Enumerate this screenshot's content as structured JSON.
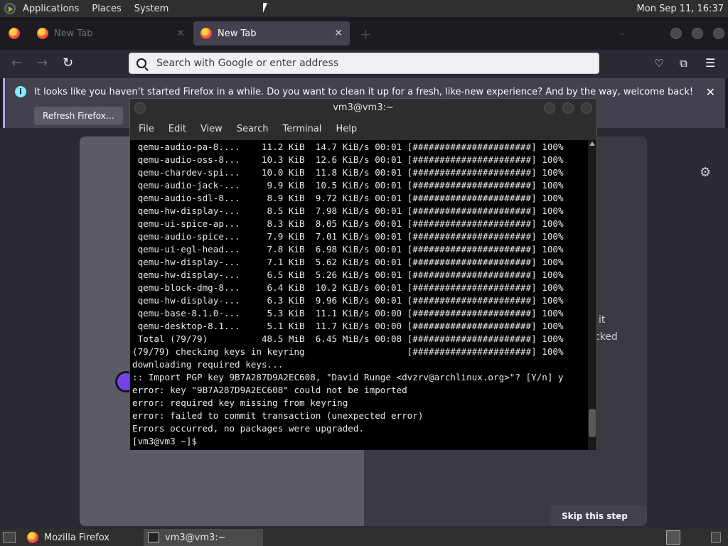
{
  "top_panel": {
    "menus": [
      "Applications",
      "Places",
      "System"
    ],
    "clock": "Mon Sep 11, 16:37"
  },
  "firefox": {
    "tabs": [
      {
        "label": "New Tab",
        "active": false
      },
      {
        "label": "New Tab",
        "active": true
      }
    ],
    "urlbar": {
      "placeholder": "Search with Google or enter address"
    },
    "notification": {
      "message": "It looks like you haven’t started Firefox in a while. Do you want to clean it up for a fresh, like-new experience? And by the way, welcome back!",
      "button": "Refresh Firefox…"
    },
    "onboarding": {
      "partial_text_1": "it",
      "partial_text_2": "cked",
      "skip_button": "Skip this step →",
      "progress_fraction": 0.33
    }
  },
  "terminal": {
    "title": "vm3@vm3:~",
    "menu": [
      "File",
      "Edit",
      "View",
      "Search",
      "Terminal",
      "Help"
    ],
    "lines": [
      " qemu-audio-pa-8....    11.2 KiB  14.7 KiB/s 00:01 [######################] 100%",
      " qemu-audio-oss-8...    10.3 KiB  12.6 KiB/s 00:01 [######################] 100%",
      " qemu-chardev-spi...    10.0 KiB  11.8 KiB/s 00:01 [######################] 100%",
      " qemu-audio-jack-...     9.9 KiB  10.5 KiB/s 00:01 [######################] 100%",
      " qemu-audio-sdl-8...     8.9 KiB  9.72 KiB/s 00:01 [######################] 100%",
      " qemu-hw-display-...     8.5 KiB  7.98 KiB/s 00:01 [######################] 100%",
      " qemu-ui-spice-ap...     8.3 KiB  8.05 KiB/s 00:01 [######################] 100%",
      " qemu-audio-spice...     7.9 KiB  7.01 KiB/s 00:01 [######################] 100%",
      " qemu-ui-egl-head...     7.8 KiB  6.98 KiB/s 00:01 [######################] 100%",
      " qemu-hw-display-...     7.1 KiB  5.62 KiB/s 00:01 [######################] 100%",
      " qemu-hw-display-...     6.5 KiB  5.26 KiB/s 00:01 [######################] 100%",
      " qemu-block-dmg-8...     6.4 KiB  10.2 KiB/s 00:01 [######################] 100%",
      " qemu-hw-display-...     6.3 KiB  9.96 KiB/s 00:01 [######################] 100%",
      " qemu-base-8.1.0-...     5.3 KiB  11.1 KiB/s 00:00 [######################] 100%",
      " qemu-desktop-8.1...     5.1 KiB  11.7 KiB/s 00:00 [######################] 100%",
      " Total (79/79)          48.5 MiB  6.45 MiB/s 00:08 [######################] 100%",
      "(79/79) checking keys in keyring                   [######################] 100%",
      "downloading required keys...",
      ":: Import PGP key 9B7A287D9A2EC608, \"David Runge <dvzrv@archlinux.org>\"? [Y/n] y",
      "error: key \"9B7A287D9A2EC608\" could not be imported",
      "error: required key missing from keyring",
      "error: failed to commit transaction (unexpected error)",
      "Errors occurred, no packages were upgraded.",
      "[vm3@vm3 ~]$ "
    ]
  },
  "taskbar": {
    "items": [
      "Mozilla Firefox",
      "vm3@vm3:~"
    ]
  }
}
